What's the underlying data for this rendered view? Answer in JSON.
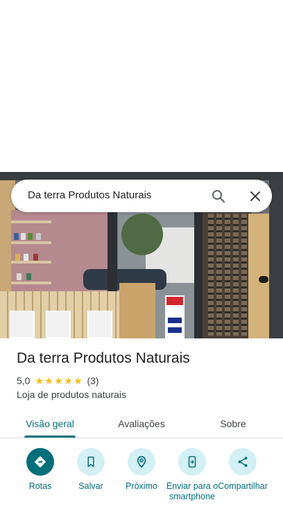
{
  "search": {
    "query": "Da terra Produtos Naturais"
  },
  "place": {
    "title": "Da terra Produtos Naturais",
    "rating": "5,0",
    "stars": 5,
    "review_count": "(3)",
    "category": "Loja de produtos naturais"
  },
  "tabs": [
    {
      "label": "Visão geral",
      "active": true
    },
    {
      "label": "Avaliações",
      "active": false
    },
    {
      "label": "Sobre",
      "active": false
    }
  ],
  "actions": [
    {
      "label": "Rotas",
      "icon": "directions-icon"
    },
    {
      "label": "Salvar",
      "icon": "bookmark-icon"
    },
    {
      "label": "Próximo",
      "icon": "nearby-icon"
    },
    {
      "label": "Enviar para o smartphone",
      "icon": "send-to-phone-icon"
    },
    {
      "label": "Compartilhar",
      "icon": "share-icon"
    }
  ],
  "colors": {
    "accent": "#00707a",
    "action_bg": "#d3f0f4",
    "star": "#fbbc04"
  }
}
